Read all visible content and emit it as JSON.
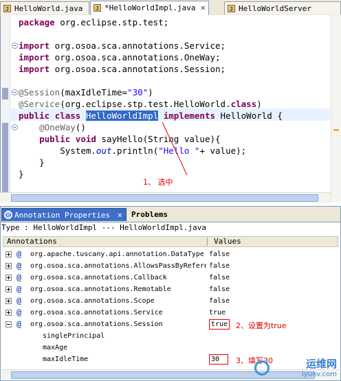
{
  "editor_tabs": [
    {
      "label": "HelloWorld.java",
      "active": false
    },
    {
      "label": "*HelloWorldImpl.java",
      "active": true
    },
    {
      "label": "HelloWorldServer",
      "active": false
    }
  ],
  "code": {
    "package_kw": "package",
    "package_name": " org.eclipse.stp.test;",
    "imports": [
      {
        "kw": "import",
        "text": " org.osoa.sca.annotations.Service;"
      },
      {
        "kw": "import",
        "text": " org.osoa.sca.annotations.OneWay;"
      },
      {
        "kw": "import",
        "text": " org.osoa.sca.annotations.Session;"
      }
    ],
    "session_ann": "@Session",
    "session_args_pre": "(maxIdleTime=",
    "session_str": "\"30\"",
    "session_args_post": ")",
    "service_ann": "@Service",
    "service_args": "(org.eclipse.stp.test.HelloWorld.",
    "service_class_kw": "class",
    "service_close": ")",
    "public_kw": "public",
    "class_kw": "class",
    "class_name": "HelloWorldImpl",
    "implements_kw": "implements",
    "iface": " HelloWorld {",
    "oneway_ann": "@OneWay",
    "oneway_parens": "()",
    "method_public": "public",
    "method_void": "void",
    "method_sig": " sayHello(String value){",
    "sys_pre": "System.",
    "sys_out": "out",
    "sys_mid": ".println(",
    "sys_str": "\"Hello \"",
    "sys_post": "+ value);",
    "close1": "}",
    "close2": "}"
  },
  "callouts": {
    "select": "1、  选中",
    "set_true": "2、设置为true",
    "fill_30": "3、填写30"
  },
  "panel": {
    "tab_active": "Annotation Properties",
    "tab_inactive": "Problems",
    "type_line": "Type : HelloWorldImpl --- HelloWorldImpl.java",
    "col_annotations": "Annotations",
    "col_values": "Values",
    "rows": [
      {
        "name": "org.apache.tuscany.api.annotation.DataType",
        "value": "false"
      },
      {
        "name": "org.osoa.sca.annotations.AllowsPassByReference",
        "value": "false"
      },
      {
        "name": "org.osoa.sca.annotations.Callback",
        "value": "false"
      },
      {
        "name": "org.osoa.sca.annotations.Remotable",
        "value": "false"
      },
      {
        "name": "org.osoa.sca.annotations.Scope",
        "value": "false"
      },
      {
        "name": "org.osoa.sca.annotations.Service",
        "value": "true"
      },
      {
        "name": "org.osoa.sca.annotations.Session",
        "value": "true"
      }
    ],
    "children": [
      {
        "name": "singlePrincipal",
        "value": ""
      },
      {
        "name": "maxAge",
        "value": ""
      },
      {
        "name": "maxIdleTime",
        "value": "30"
      }
    ]
  },
  "watermark": {
    "title": "运维网",
    "url": "iyunv.com"
  },
  "icons": [
    "java-file-icon",
    "close-icon",
    "fold-icon",
    "annotation-icon",
    "expand-icon",
    "collapse-icon"
  ]
}
